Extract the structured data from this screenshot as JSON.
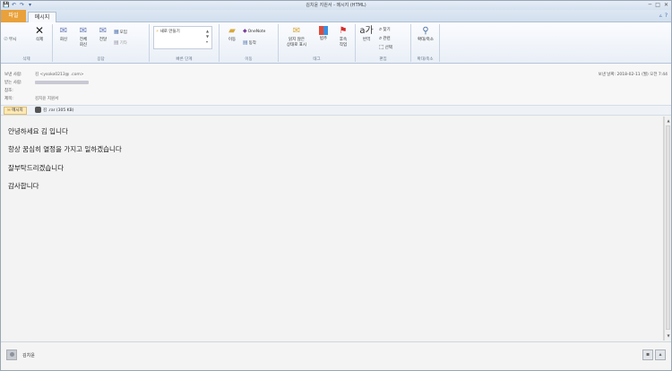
{
  "window": {
    "title": "김치윤 지원서 - 메시지 (HTML)",
    "qat": [
      "💾",
      "↶",
      "↷",
      "▾"
    ],
    "controls": [
      "─",
      "□",
      "✕"
    ]
  },
  "tabs": {
    "file": "파일",
    "message": "메시지"
  },
  "ribbon": {
    "groups": {
      "delete": {
        "label": "삭제",
        "ignore": "무시",
        "delete": "삭제"
      },
      "respond": {
        "label": "응답",
        "reply": "회신",
        "reply_all": "전체\n회신",
        "forward": "전달",
        "meeting": "모임",
        "more": "기타"
      },
      "quick_steps": {
        "label": "빠른 단계",
        "new": "새로 만들기"
      },
      "move": {
        "label": "이동",
        "move": "이동",
        "onenote": "OneNote",
        "actions": "동작"
      },
      "tags": {
        "label": "태그",
        "mark_unread": "읽지 않은\n상태로 표시",
        "categorize": "범주",
        "follow_up": "후속\n작업"
      },
      "editing": {
        "label": "편집",
        "translate": "번역",
        "find": "찾기",
        "related": "관련",
        "select": "선택"
      },
      "zoom": {
        "label": "확대/축소",
        "zoom": "확대/축소"
      }
    }
  },
  "header": {
    "from_label": "보낸 사람:",
    "from_value": "김  <ysoko0213@          .com>",
    "to_label": "받는 사람:",
    "cc_label": "참조:",
    "subject_label": "제목:",
    "subject_value": "김치윤 지원서",
    "sent_label": "보낸 날짜:",
    "sent_value": "2018-02-11 (월) 오전 7:44"
  },
  "attachments": {
    "message_tab": "메시지",
    "file": "김  .rar (305 KB)"
  },
  "body": {
    "lines": [
      "안녕하세요 김   입니다",
      "항상 꿈심히 열정을 가지고 일하겠습니다",
      "잘부탁드리겠습니다",
      "감사합니다"
    ]
  },
  "people_pane": {
    "name": "김치윤"
  }
}
